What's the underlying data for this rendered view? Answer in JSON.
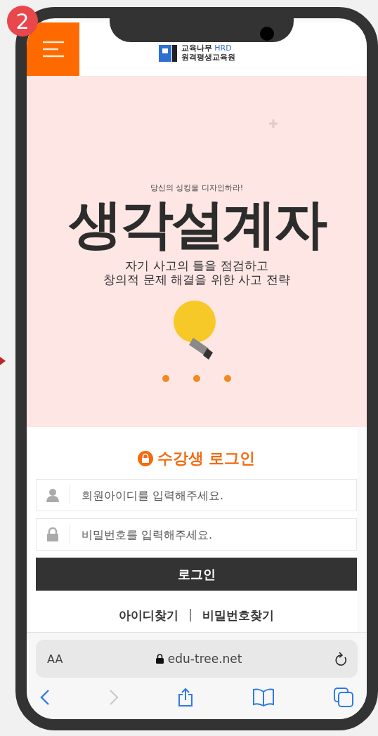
{
  "step_badge": "2",
  "header": {
    "logo_line1": "교육나무",
    "logo_hrd": "HRD",
    "logo_line2": "원격평생교육원"
  },
  "banner": {
    "tagline": "당신의 싱킹을 디자인하라!",
    "title": "생각설계자",
    "subtitle_lines": [
      "자기 사고의 틀을 점검하고",
      "창의적 문제 해결을 위한 사고 전략"
    ],
    "dots": [
      {
        "selected": false
      },
      {
        "selected": false
      },
      {
        "selected": false
      }
    ]
  },
  "login": {
    "title": "수강생 로그인",
    "fields": [
      {
        "kind": "user",
        "placeholder": "회원아이디를 입력해주세요."
      },
      {
        "kind": "password",
        "placeholder": "비밀번호를 입력해주세요."
      }
    ],
    "button": "로그인",
    "links": [
      "아이디찾기",
      "비밀번호찾기"
    ],
    "separator": "|"
  },
  "browser": {
    "text_size": "AA",
    "url": "edu-tree.net"
  }
}
